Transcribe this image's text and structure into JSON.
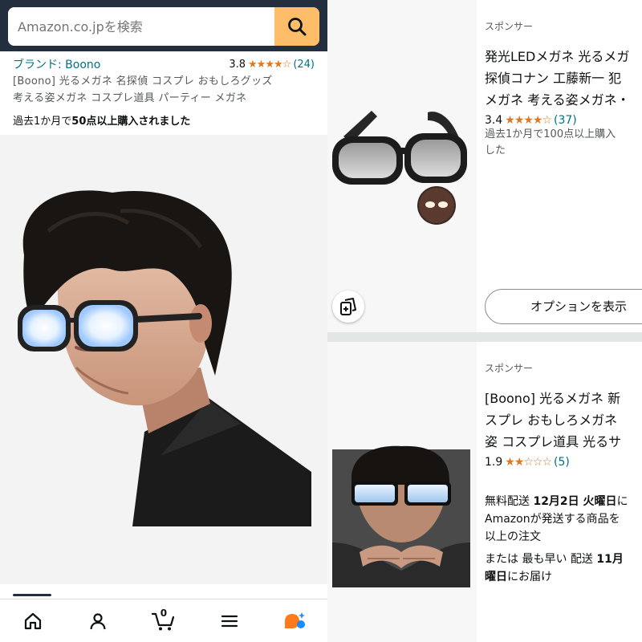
{
  "colors": {
    "header_bg": "#232f3e",
    "search_button": "#febd69",
    "link": "#007185",
    "star": "#de7921"
  },
  "search": {
    "placeholder": "Amazon.co.jpを検索"
  },
  "product": {
    "brand": "ブランド: Boono",
    "rating": "3.8",
    "stars": "★★★★☆",
    "review_count": "(24)",
    "title_line1": "[Boono] 光るメガネ 名探偵 コスプレ おもしろグッズ",
    "title_line2": "考える姿メガネ コスプレ道具 パーティー メガネ",
    "bought_prefix": "過去1か月で",
    "bought_bold": "50点以上購入されました",
    "photo_icon": "glowing-glasses-man-photo"
  },
  "bottom_nav": {
    "cart_count": "0",
    "items": [
      "home-icon",
      "account-icon",
      "cart-icon",
      "menu-icon",
      "rufus-icon"
    ]
  },
  "sponsored": [
    {
      "label": "スポンサー",
      "title_line1": "発光LEDメガネ 光るメガ",
      "title_line2": "探偵コナン 工藤新一 犯",
      "title_line3": "メガネ 考える姿メガネ・",
      "rating": "3.4",
      "stars": "★★★★☆",
      "review_count": "(37)",
      "bought_line1": "過去1か月で100点以上購入",
      "bought_line2": "した",
      "option_button": "オプションを表示",
      "compare_icon": "compare-cards-icon"
    },
    {
      "label": "スポンサー",
      "title_line1": "[Boono] 光るメガネ 新",
      "title_line2": "スプレ おもしろメガネ",
      "title_line3": "姿 コスプレ道具 光るサ",
      "rating": "1.9",
      "stars": "★★☆☆☆",
      "review_count": "(5)",
      "ship_prefix": "無料配送 ",
      "ship_date": "12月2日 火曜日",
      "ship_suffix": "に",
      "ship_line2": "Amazonが発送する商品を",
      "ship_line3": "以上の注文",
      "fast_prefix": "または 最も早い 配送 ",
      "fast_date": "11月",
      "fast_line2_bold": "曜日",
      "fast_line2": "にお届け"
    }
  ]
}
